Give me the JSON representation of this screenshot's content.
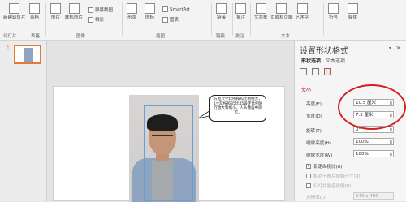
{
  "ribbon": {
    "buttons": [
      "新建幻灯片",
      "表格",
      "图片",
      "联机图片",
      "屏幕截图",
      "相册",
      "形状",
      "图标",
      "SmartArt",
      "图表",
      "链接",
      "批注",
      "文本框",
      "页眉和页脚",
      "艺术字",
      "符号",
      "媒体"
    ],
    "groups": [
      "幻灯片",
      "表格",
      "图像",
      "插图",
      "链接",
      "批注",
      "文本"
    ]
  },
  "thumbs": {
    "number": "1"
  },
  "callout": {
    "text": "方框尺寸比例按照比例拖大，1寸就按照35比45设定比例进行放大和缩小，人头像居中即可。"
  },
  "pane": {
    "title": "设置形状格式",
    "tabs": [
      "形状选项",
      "文本选项"
    ],
    "section": "大小",
    "height_label": "高度(E)",
    "height_value": "10.5 厘米",
    "width_label": "宽度(D)",
    "width_value": "7.5 厘米",
    "rotation_label": "旋转(T)",
    "rotation_value": "0°",
    "scale_h_label": "缩放高度(H)",
    "scale_h_value": "100%",
    "scale_w_label": "缩放宽度(W)",
    "scale_w_value": "100%",
    "lock_label": "锁定纵横比(A)",
    "relative_label": "相对于图片原始尺寸(R)",
    "best_label": "幻灯片最佳比例(B)",
    "resolution_label": "分辨率(O)",
    "resolution_value": "640 x 480"
  }
}
